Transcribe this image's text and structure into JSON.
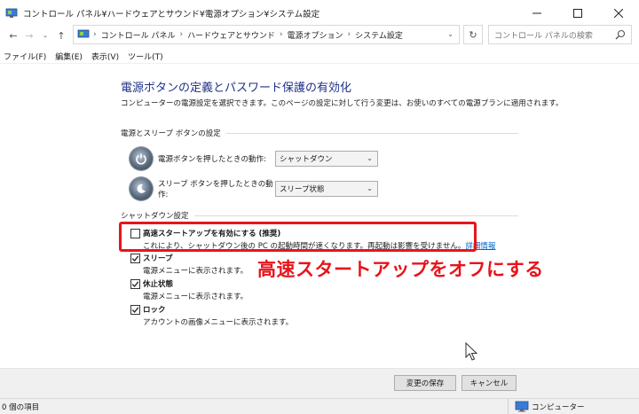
{
  "window": {
    "title": "コントロール パネル¥ハードウェアとサウンド¥電源オプション¥システム設定"
  },
  "address": {
    "crumbs": [
      "コントロール パネル",
      "ハードウェアとサウンド",
      "電源オプション",
      "システム設定"
    ],
    "search_placeholder": "コントロール パネルの検索"
  },
  "menu": [
    "ファイル(F)",
    "編集(E)",
    "表示(V)",
    "ツール(T)"
  ],
  "main": {
    "title": "電源ボタンの定義とパスワード保護の有効化",
    "description": "コンピューターの電源設定を選択できます。このページの設定に対して行う変更は、お使いのすべての電源プランに適用されます。",
    "power_section": {
      "header": "電源とスリープ ボタンの設定",
      "power_button_label": "電源ボタンを押したときの動作:",
      "power_button_value": "シャットダウン",
      "sleep_button_label": "スリープ ボタンを押したときの動作:",
      "sleep_button_value": "スリープ状態"
    },
    "shutdown_section": {
      "header": "シャットダウン設定",
      "options": [
        {
          "title": "高速スタートアップを有効にする (推奨)",
          "desc": "これにより、シャットダウン後の PC の起動時間が速くなります。再起動は影響を受けません。",
          "link": "詳細情報",
          "checked": false
        },
        {
          "title": "スリープ",
          "desc": "電源メニューに表示されます。",
          "checked": true
        },
        {
          "title": "休止状態",
          "desc": "電源メニューに表示されます。",
          "checked": true
        },
        {
          "title": "ロック",
          "desc": "アカウントの画像メニューに表示されます。",
          "checked": true
        }
      ]
    },
    "annotation": "高速スタートアップをオフにする"
  },
  "buttons": {
    "save": "変更の保存",
    "cancel": "キャンセル"
  },
  "status": {
    "items": "0 個の項目",
    "location": "コンピューター"
  },
  "colors": {
    "title_blue": "#1e3287",
    "annotation_red": "#e8141b",
    "link_blue": "#0066cc"
  }
}
